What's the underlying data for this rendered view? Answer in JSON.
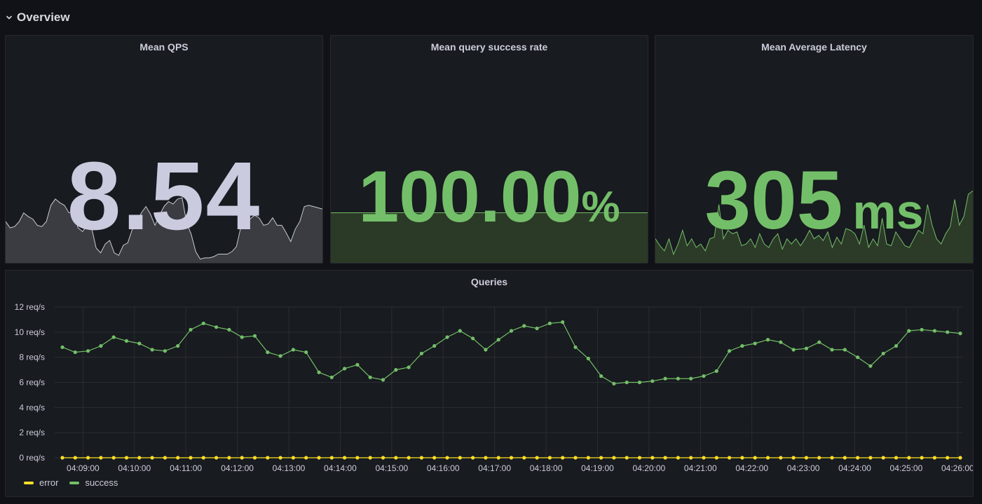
{
  "row": {
    "title": "Overview"
  },
  "stats": {
    "qps": {
      "title": "Mean QPS",
      "value": "8.54",
      "color": "#cbcbe0"
    },
    "success_rate": {
      "title": "Mean query success rate",
      "value": "100.00",
      "unit": "%",
      "color": "#73bf69"
    },
    "latency": {
      "title": "Mean Average Latency",
      "value": "305",
      "unit": "ms",
      "color": "#73bf69"
    }
  },
  "queries": {
    "title": "Queries",
    "legend": [
      {
        "name": "error",
        "color": "#fade2a"
      },
      {
        "name": "success",
        "color": "#73bf69"
      }
    ]
  },
  "chart_data": {
    "type": "line",
    "title": "Queries",
    "xlabel": "",
    "ylabel": "",
    "x_ticks": [
      "04:09:00",
      "04:10:00",
      "04:11:00",
      "04:12:00",
      "04:13:00",
      "04:14:00",
      "04:15:00",
      "04:16:00",
      "04:17:00",
      "04:18:00",
      "04:19:00",
      "04:20:00",
      "04:21:00",
      "04:22:00",
      "04:23:00",
      "04:24:00",
      "04:25:00",
      "04:26:00"
    ],
    "y_ticks": [
      "0 req/s",
      "2 req/s",
      "4 req/s",
      "6 req/s",
      "8 req/s",
      "10 req/s",
      "12 req/s"
    ],
    "ylim": [
      0,
      12
    ],
    "x_minutes_range": [
      8.45,
      26.05
    ],
    "grid": true,
    "legend_position": "bottom-left",
    "series": [
      {
        "name": "success",
        "color": "#73bf69",
        "values": [
          8.8,
          8.4,
          8.5,
          8.9,
          9.6,
          9.3,
          9.1,
          8.6,
          8.5,
          8.9,
          10.2,
          10.7,
          10.4,
          10.2,
          9.6,
          9.7,
          8.4,
          8.1,
          8.6,
          8.4,
          6.8,
          6.4,
          7.1,
          7.4,
          6.4,
          6.2,
          7.0,
          7.2,
          8.3,
          8.9,
          9.6,
          10.1,
          9.5,
          8.6,
          9.4,
          10.1,
          10.5,
          10.3,
          10.7,
          10.8,
          8.8,
          7.9,
          6.5,
          5.9,
          6.0,
          6.0,
          6.1,
          6.3,
          6.3,
          6.3,
          6.5,
          6.9,
          8.5,
          8.9,
          9.1,
          9.4,
          9.2,
          8.6,
          8.7,
          9.2,
          8.6,
          8.6,
          8.0,
          7.3,
          8.3,
          8.9,
          10.1,
          10.2,
          10.1,
          10.0,
          9.9
        ]
      },
      {
        "name": "error",
        "color": "#fade2a",
        "values": [
          0,
          0,
          0,
          0,
          0,
          0,
          0,
          0,
          0,
          0,
          0,
          0,
          0,
          0,
          0,
          0,
          0,
          0,
          0,
          0,
          0,
          0,
          0,
          0,
          0,
          0,
          0,
          0,
          0,
          0,
          0,
          0,
          0,
          0,
          0,
          0,
          0,
          0,
          0,
          0,
          0,
          0,
          0,
          0,
          0,
          0,
          0,
          0,
          0,
          0,
          0,
          0,
          0,
          0,
          0,
          0,
          0,
          0,
          0,
          0,
          0,
          0,
          0,
          0,
          0,
          0,
          0,
          0,
          0,
          0,
          0
        ]
      }
    ]
  },
  "sparklines": {
    "qps": [
      8.9,
      8.4,
      8.5,
      8.9,
      9.6,
      9.3,
      9.1,
      8.6,
      8.5,
      8.9,
      10.2,
      10.7,
      10.4,
      10.2,
      9.6,
      9.7,
      8.4,
      8.1,
      8.6,
      8.4,
      6.8,
      6.4,
      7.1,
      7.4,
      6.4,
      6.2,
      7.0,
      7.2,
      8.3,
      8.9,
      9.6,
      10.1,
      9.5,
      8.6,
      9.4,
      10.1,
      10.5,
      10.3,
      10.7,
      10.8,
      8.8,
      7.9,
      6.5,
      5.9,
      6.0,
      6.0,
      6.1,
      6.3,
      6.3,
      6.3,
      6.5,
      6.9,
      8.5,
      8.9,
      9.1,
      9.4,
      9.2,
      8.6,
      8.7,
      9.2,
      8.6,
      8.6,
      8.0,
      7.3,
      8.3,
      8.9,
      10.1,
      10.2,
      10.1,
      10.0,
      9.9
    ],
    "latency": [
      290,
      282,
      276,
      290,
      272,
      284,
      300,
      282,
      290,
      280,
      284,
      276,
      290,
      292,
      330,
      290,
      300,
      296,
      298,
      282,
      284,
      290,
      280,
      296,
      284,
      280,
      290,
      296,
      278,
      290,
      284,
      290,
      282,
      290,
      300,
      290,
      294,
      288,
      298,
      280,
      292,
      284,
      302,
      300,
      296,
      284,
      306,
      280,
      290,
      282,
      314,
      284,
      282,
      298,
      290,
      282,
      280,
      290,
      300,
      296,
      330,
      306,
      290,
      284,
      296,
      304,
      336,
      306,
      316,
      342,
      346
    ]
  }
}
